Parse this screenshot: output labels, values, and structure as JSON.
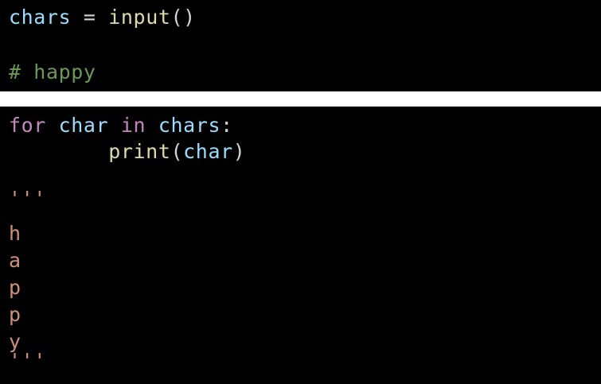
{
  "editor": {
    "top_lines": [
      {
        "var": "chars",
        "op": " = ",
        "fn": "input",
        "paren": "()"
      },
      {
        "comment": "# happy"
      }
    ],
    "bottom": {
      "for_kw": "for",
      "loop_var": "char",
      "in_kw": "in",
      "iterable": "chars",
      "colon": ":",
      "indent": "        ",
      "call_fn": "print",
      "call_open": "(",
      "call_arg": "char",
      "call_close": ")",
      "doc_open": "'''",
      "output": [
        "h",
        "a",
        "p",
        "p",
        "y"
      ],
      "doc_close": "'''"
    }
  },
  "colors": {
    "background": "#000000",
    "separator": "#ffffff",
    "variable": "#9cdcfe",
    "function": "#dcdcaa",
    "keyword": "#c586c0",
    "comment": "#6a9955",
    "string": "#ce9178",
    "punctuation": "#d4d4d4"
  }
}
